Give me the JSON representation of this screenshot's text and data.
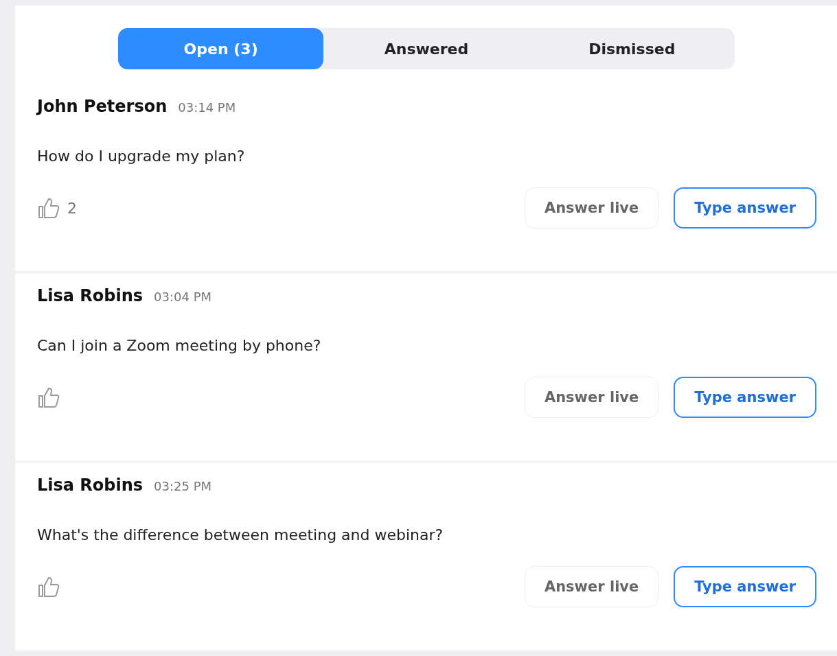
{
  "tabs": [
    {
      "label": "Open (3)",
      "selected": true
    },
    {
      "label": "Answered",
      "selected": false
    },
    {
      "label": "Dismissed",
      "selected": false
    }
  ],
  "questions": [
    {
      "author": "John Peterson",
      "time": "03:14 PM",
      "text": "How do I upgrade my plan?",
      "upvotes": "2",
      "buttons": [
        "Answer live",
        "Type answer"
      ]
    },
    {
      "author": "Lisa Robins",
      "time": "03:04 PM",
      "text": "Can I join a Zoom meeting by phone?",
      "buttons": [
        "Answer live",
        "Type answer"
      ]
    },
    {
      "author": "Lisa Robins",
      "time": "03:25 PM",
      "text": "What's the difference between meeting and webinar?",
      "buttons": [
        "Answer live",
        "Type answer"
      ]
    }
  ]
}
